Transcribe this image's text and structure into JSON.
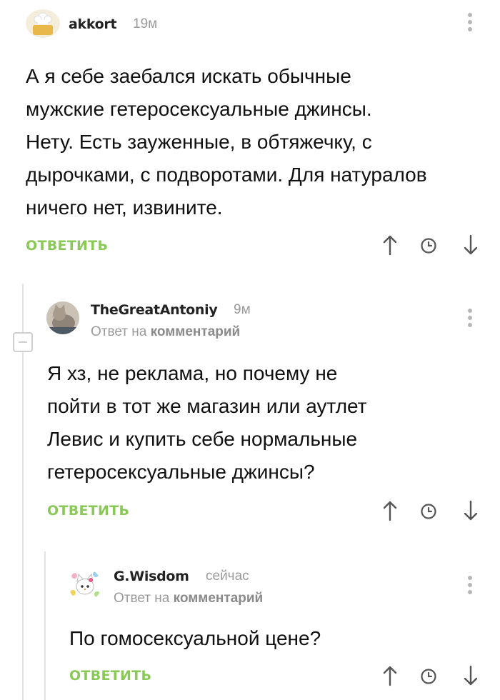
{
  "comments": [
    {
      "username": "akkort",
      "time": "19м",
      "text_lines": [
        "А я себе заебался искать обычные",
        "мужские гетеросексуальные джинсы.",
        "Нету. Есть зауженные, в обтяжечку, с",
        "дырочками, с подворотами. Для натуралов",
        "ничего нет, извините."
      ],
      "reply_label": "ОТВЕТИТЬ"
    },
    {
      "username": "TheGreatAntoniy",
      "time": "9м",
      "reply_to_prefix": "Ответ на",
      "reply_to_link": "комментарий",
      "text_lines": [
        "Я хз, не реклама, но почему не",
        "пойти в тот же магазин или аутлет",
        "Левис и купить себе нормальные",
        "гетеросексуальные джинсы?"
      ],
      "reply_label": "ОТВЕТИТЬ"
    },
    {
      "username": "G.Wisdom",
      "time": "сейчас",
      "reply_to_prefix": "Ответ на",
      "reply_to_link": "комментарий",
      "text_lines": [
        "По гомосексуальной цене?"
      ],
      "reply_label": "ОТВЕТИТЬ"
    }
  ],
  "colors": {
    "accent_green": "#8ac858",
    "meta_gray": "#9a9a9a",
    "icon_gray": "#555555"
  }
}
